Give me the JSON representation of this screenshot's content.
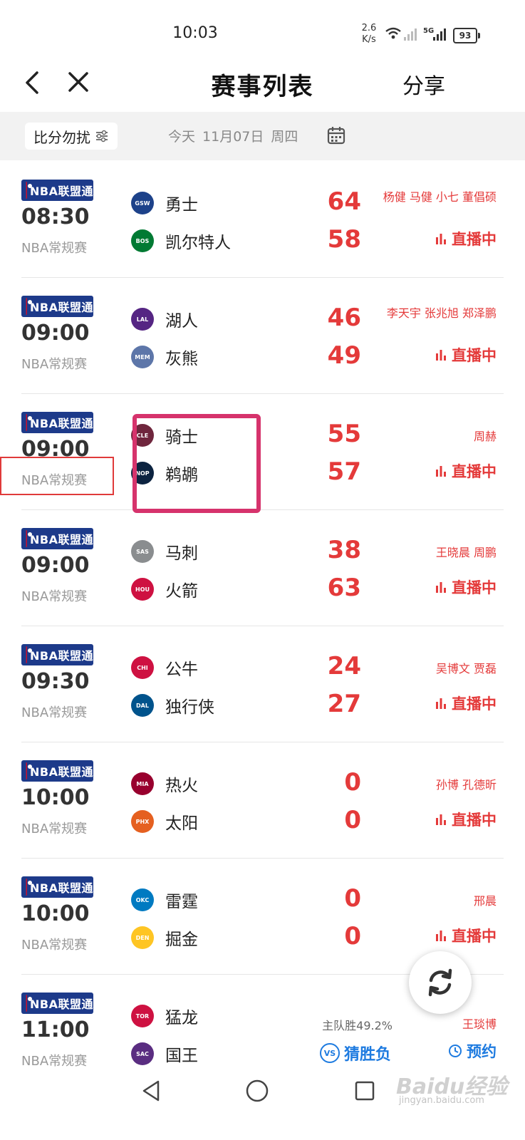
{
  "status_bar": {
    "time": "10:03",
    "speed_value": "2.6",
    "speed_unit": "K/s",
    "network": "5G",
    "battery": "93"
  },
  "nav": {
    "title": "赛事列表",
    "share_label": "分享"
  },
  "filter": {
    "chip_label": "比分勿扰",
    "date_text": "今天 11月07日 周四"
  },
  "badge_text": "NBA联盟通",
  "games": [
    {
      "time": "08:30",
      "league": "NBA常规赛",
      "team1": "勇士",
      "team2": "凯尔特人",
      "score1": "64",
      "score2": "58",
      "commentators": "杨健 马健 小七 董倡硕",
      "status": "直播中"
    },
    {
      "time": "09:00",
      "league": "NBA常规赛",
      "team1": "湖人",
      "team2": "灰熊",
      "score1": "46",
      "score2": "49",
      "commentators": "李天宇 张兆旭 郑泽鹏",
      "status": "直播中"
    },
    {
      "time": "09:00",
      "league": "NBA常规赛",
      "team1": "骑士",
      "team2": "鹈鹕",
      "score1": "55",
      "score2": "57",
      "commentators": "周赫",
      "status": "直播中"
    },
    {
      "time": "09:00",
      "league": "NBA常规赛",
      "team1": "马刺",
      "team2": "火箭",
      "score1": "38",
      "score2": "63",
      "commentators": "王晓晨 周鹏",
      "status": "直播中"
    },
    {
      "time": "09:30",
      "league": "NBA常规赛",
      "team1": "公牛",
      "team2": "独行侠",
      "score1": "24",
      "score2": "27",
      "commentators": "吴博文 贾磊",
      "status": "直播中"
    },
    {
      "time": "10:00",
      "league": "NBA常规赛",
      "team1": "热火",
      "team2": "太阳",
      "score1": "0",
      "score2": "0",
      "commentators": "孙博 孔德昕",
      "status": "直播中"
    },
    {
      "time": "10:00",
      "league": "NBA常规赛",
      "team1": "雷霆",
      "team2": "掘金",
      "score1": "0",
      "score2": "0",
      "commentators": "邢晨",
      "status": "直播中"
    }
  ],
  "last_game": {
    "time": "11:00",
    "league": "NBA常规赛",
    "team1": "猛龙",
    "team2": "国王",
    "home_win_prob": "主队胜49.2%",
    "guess_label": "猜胜负",
    "commentators": "王琰博",
    "reserve_label": "预约"
  },
  "watermark": {
    "brand": "Baidu经验",
    "url": "jingyan.baidu.com"
  },
  "colors": {
    "score_red": "#e43a3a",
    "accent_blue": "#1e7be0",
    "badge_blue": "#1d3a8a",
    "highlight_pink": "#d6336c"
  },
  "team_logo_colors": [
    "#1d428a",
    "#007a33",
    "#552583",
    "#5d76a9",
    "#6f263d",
    "#0c2340",
    "#8a8d8f",
    "#ce1141",
    "#ce1141",
    "#00538c",
    "#98002e",
    "#e56020",
    "#007ac1",
    "#fec524",
    "#ce1141",
    "#5a2d81"
  ]
}
